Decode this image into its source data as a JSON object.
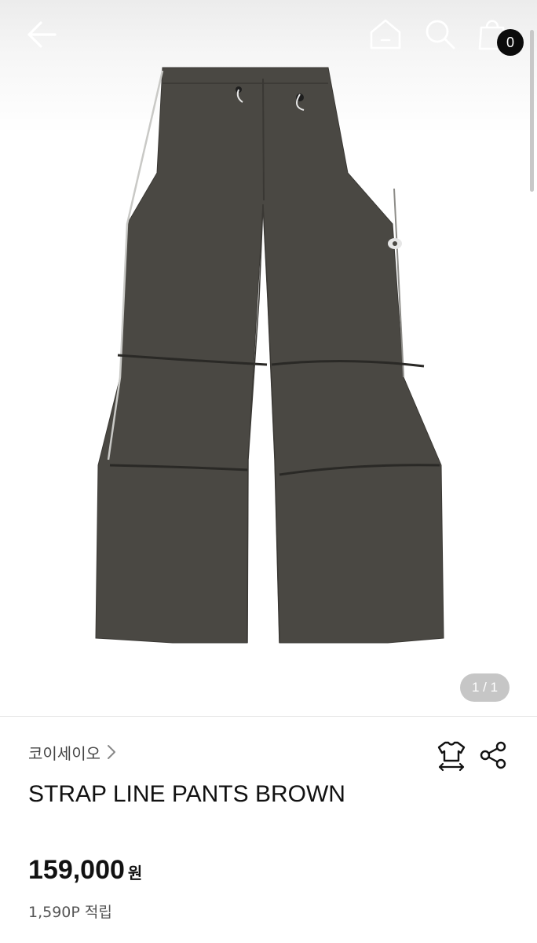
{
  "header": {
    "cart_count": "0"
  },
  "gallery": {
    "pager": "1 / 1"
  },
  "product": {
    "brand": "코이세이오",
    "title": "STRAP LINE PANTS BROWN",
    "price": "159,000",
    "currency": "원",
    "points": "1,590P 적립",
    "color": "#4a4843"
  },
  "icons": {
    "back": "back-arrow-icon",
    "home": "home-icon",
    "search": "search-icon",
    "cart": "shopping-bag-icon",
    "brand_chevron": "chevron-right-icon",
    "size": "size-guide-icon",
    "share": "share-icon"
  }
}
